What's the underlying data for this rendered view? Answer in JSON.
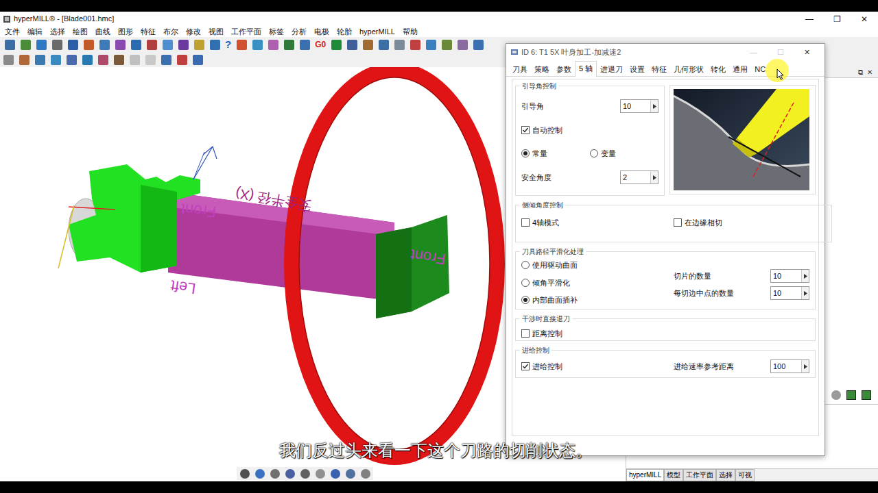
{
  "window": {
    "title": "hyperMILL® - [Blade001.hmc]",
    "controls": [
      "—",
      "❐",
      "✕"
    ]
  },
  "menu": [
    "文件",
    "编辑",
    "选择",
    "绘图",
    "曲线",
    "图形",
    "特征",
    "布尔",
    "修改",
    "视图",
    "工作平面",
    "标签",
    "分析",
    "电极",
    "轮胎",
    "hyperMILL",
    "帮助"
  ],
  "toolbar": {
    "glyphs": [
      "?",
      "G0"
    ]
  },
  "viewport": {
    "labels": [
      "Front",
      "安全半径 (X)",
      "Front",
      "Left"
    ]
  },
  "dialog": {
    "title": "ID 6: T1 5X 叶身加工-加减速2",
    "controls": [
      "—",
      "☐",
      "✕"
    ],
    "tabs": [
      {
        "label": "刀具",
        "selected": false
      },
      {
        "label": "策略",
        "selected": false
      },
      {
        "label": "参数",
        "selected": false
      },
      {
        "label": "5 轴",
        "selected": true
      },
      {
        "label": "进退刀",
        "selected": false
      },
      {
        "label": "设置",
        "selected": false
      },
      {
        "label": "特征",
        "selected": false
      },
      {
        "label": "几何形状",
        "selected": false
      },
      {
        "label": "转化",
        "selected": false
      },
      {
        "label": "通用",
        "selected": false
      },
      {
        "label": "NC",
        "selected": false
      }
    ],
    "lead": {
      "title": "引导角控制",
      "angle": {
        "label": "引导角",
        "value": "10"
      },
      "auto": {
        "label": "自动控制",
        "checked": true
      },
      "modes": [
        {
          "label": "常量",
          "selected": true
        },
        {
          "label": "变量",
          "selected": false
        }
      ],
      "safety": {
        "label": "安全角度",
        "value": "2"
      }
    },
    "tilt": {
      "title": "侧倾角度控制",
      "options": [
        {
          "label": "4轴模式",
          "checked": false
        },
        {
          "label": "在边缘相切",
          "checked": false
        }
      ]
    },
    "smoothing": {
      "title": "刀具路径平滑化处理",
      "options": [
        {
          "label": "使用驱动曲面",
          "selected": false
        },
        {
          "label": "倾角平滑化",
          "selected": false
        },
        {
          "label": "内部曲面插补",
          "selected": true
        }
      ],
      "fields": [
        {
          "label": "切片的数量",
          "value": "10"
        },
        {
          "label": "每切边中点的数量",
          "value": "10"
        }
      ]
    },
    "retract": {
      "title": "干涉时直接退刀",
      "option": {
        "label": "距离控制",
        "checked": false
      }
    },
    "feed": {
      "title": "进给控制",
      "option": {
        "label": "进给控制",
        "checked": true
      },
      "field": {
        "label": "进给速率参考距离",
        "value": "100"
      }
    }
  },
  "side_panel": {
    "controls": [
      "⧉",
      "✕"
    ],
    "tabs": [
      {
        "label": "hyperMILL",
        "selected": true
      },
      {
        "label": "模型",
        "selected": false
      },
      {
        "label": "工作平面",
        "selected": false
      },
      {
        "label": "选择",
        "selected": false
      },
      {
        "label": "可视",
        "selected": false
      }
    ]
  },
  "subtitle": "我们反过头来看一下这个刀路的切削状态。"
}
